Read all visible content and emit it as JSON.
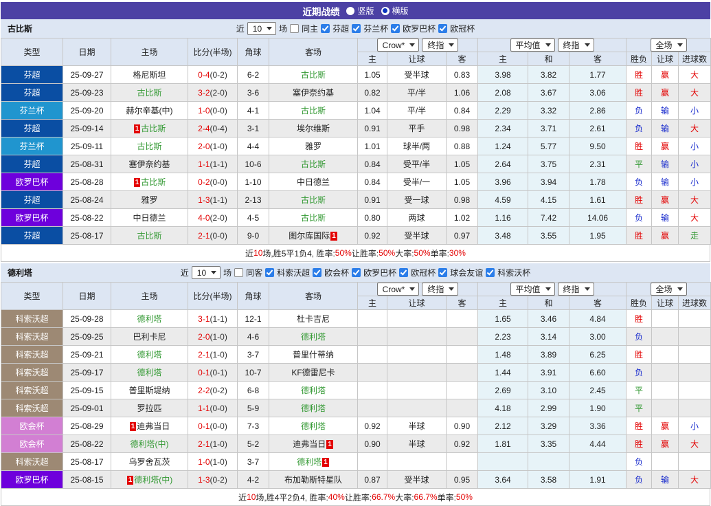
{
  "title_bar": {
    "title": "近期战绩",
    "radios": [
      {
        "label": "竖版",
        "selected": false
      },
      {
        "label": "横版",
        "selected": true
      }
    ]
  },
  "header": {
    "labels": [
      "类型",
      "日期",
      "主场",
      "比分(半场)",
      "角球",
      "客场"
    ],
    "selects": {
      "odds_company": "Crow*",
      "odds_final": "终指",
      "avg": "平均值",
      "avg_final": "终指",
      "scope": "全场"
    },
    "sub": [
      "主",
      "让球",
      "客",
      "主",
      "和",
      "客",
      "胜负",
      "让球",
      "进球数"
    ]
  },
  "type_colors": {
    "芬超": "#0a4ea3",
    "芬兰杯": "#2095cf",
    "欧罗巴杯": "#6e00dc",
    "科索沃超": "#9d8974",
    "欧会杯": "#d27fd3"
  },
  "result_colors": {
    "胜": "red",
    "赢": "red",
    "大": "red",
    "负": "blue",
    "输": "blue",
    "小": "blue",
    "平": "green",
    "走": "green"
  },
  "accent_colors": {
    "red": "#e30000",
    "blue": "#1326cc",
    "green": "#339933"
  },
  "tables": [
    {
      "team": "古比斯",
      "filter": {
        "prefix": "近",
        "games": "10",
        "suffix": "场",
        "same_label": "同主",
        "same_checked": false,
        "leagues": [
          "芬超",
          "芬兰杯",
          "欧罗巴杯",
          "欧冠杯"
        ]
      },
      "rows": [
        {
          "type": "芬超",
          "date": "25-09-27",
          "home": {
            "text": "格尼斯坦"
          },
          "score": "0-4",
          "half": "(0-2)",
          "corner": "6-2",
          "away": {
            "text": "古比斯",
            "green": true
          },
          "odds": [
            "1.05",
            "受半球",
            "0.83"
          ],
          "avg": [
            "3.98",
            "3.82",
            "1.77"
          ],
          "results": [
            "胜",
            "赢",
            "大"
          ]
        },
        {
          "type": "芬超",
          "date": "25-09-23",
          "home": {
            "text": "古比斯",
            "green": true
          },
          "score": "3-2",
          "half": "(2-0)",
          "corner": "3-6",
          "away": {
            "text": "塞伊奈约基"
          },
          "odds": [
            "0.82",
            "平/半",
            "1.06"
          ],
          "avg": [
            "2.08",
            "3.67",
            "3.06"
          ],
          "results": [
            "胜",
            "赢",
            "大"
          ]
        },
        {
          "type": "芬兰杯",
          "date": "25-09-20",
          "home": {
            "text": "赫尔辛基(中)"
          },
          "score": "1-0",
          "half": "(0-0)",
          "corner": "4-1",
          "away": {
            "text": "古比斯",
            "green": true
          },
          "odds": [
            "1.04",
            "平/半",
            "0.84"
          ],
          "avg": [
            "2.29",
            "3.32",
            "2.86"
          ],
          "results": [
            "负",
            "输",
            "小"
          ]
        },
        {
          "type": "芬超",
          "date": "25-09-14",
          "home": {
            "text": "古比斯",
            "green": true,
            "badge_before": true
          },
          "score": "2-4",
          "half": "(0-4)",
          "corner": "3-1",
          "away": {
            "text": "埃尔维斯"
          },
          "odds": [
            "0.91",
            "平手",
            "0.98"
          ],
          "avg": [
            "2.34",
            "3.71",
            "2.61"
          ],
          "results": [
            "负",
            "输",
            "大"
          ]
        },
        {
          "type": "芬兰杯",
          "date": "25-09-11",
          "home": {
            "text": "古比斯",
            "green": true
          },
          "score": "2-0",
          "half": "(1-0)",
          "corner": "4-4",
          "away": {
            "text": "雅罗"
          },
          "odds": [
            "1.01",
            "球半/两",
            "0.88"
          ],
          "avg": [
            "1.24",
            "5.77",
            "9.50"
          ],
          "results": [
            "胜",
            "赢",
            "小"
          ]
        },
        {
          "type": "芬超",
          "date": "25-08-31",
          "home": {
            "text": "塞伊奈约基"
          },
          "score": "1-1",
          "half": "(1-1)",
          "corner": "10-6",
          "away": {
            "text": "古比斯",
            "green": true
          },
          "odds": [
            "0.84",
            "受平/半",
            "1.05"
          ],
          "avg": [
            "2.64",
            "3.75",
            "2.31"
          ],
          "results": [
            "平",
            "输",
            "小"
          ]
        },
        {
          "type": "欧罗巴杯",
          "date": "25-08-28",
          "home": {
            "text": "古比斯",
            "green": true,
            "badge_before": true
          },
          "score": "0-2",
          "half": "(0-0)",
          "corner": "1-10",
          "away": {
            "text": "中日德兰"
          },
          "odds": [
            "0.84",
            "受半/一",
            "1.05"
          ],
          "avg": [
            "3.96",
            "3.94",
            "1.78"
          ],
          "results": [
            "负",
            "输",
            "小"
          ]
        },
        {
          "type": "芬超",
          "date": "25-08-24",
          "home": {
            "text": "雅罗"
          },
          "score": "1-3",
          "half": "(1-1)",
          "corner": "2-13",
          "away": {
            "text": "古比斯",
            "green": true
          },
          "odds": [
            "0.91",
            "受一球",
            "0.98"
          ],
          "avg": [
            "4.59",
            "4.15",
            "1.61"
          ],
          "results": [
            "胜",
            "赢",
            "大"
          ]
        },
        {
          "type": "欧罗巴杯",
          "date": "25-08-22",
          "home": {
            "text": "中日德兰"
          },
          "score": "4-0",
          "half": "(2-0)",
          "corner": "4-5",
          "away": {
            "text": "古比斯",
            "green": true
          },
          "odds": [
            "0.80",
            "两球",
            "1.02"
          ],
          "avg": [
            "1.16",
            "7.42",
            "14.06"
          ],
          "results": [
            "负",
            "输",
            "大"
          ]
        },
        {
          "type": "芬超",
          "date": "25-08-17",
          "home": {
            "text": "古比斯",
            "green": true
          },
          "score": "2-1",
          "half": "(0-0)",
          "corner": "9-0",
          "away": {
            "text": "图尔库国际",
            "badge_after": true
          },
          "odds": [
            "0.92",
            "受半球",
            "0.97"
          ],
          "avg": [
            "3.48",
            "3.55",
            "1.95"
          ],
          "results": [
            "胜",
            "赢",
            "走"
          ]
        }
      ],
      "summary": [
        {
          "text": "近"
        },
        {
          "text": "10",
          "red": true
        },
        {
          "text": "场,胜5平1负4, 胜率:"
        },
        {
          "text": "50%",
          "red": true
        },
        {
          "text": " 让胜率:"
        },
        {
          "text": "50%",
          "red": true
        },
        {
          "text": " 大率:"
        },
        {
          "text": "50%",
          "red": true
        },
        {
          "text": " 单率:"
        },
        {
          "text": "30%",
          "red": true
        }
      ]
    },
    {
      "team": "德利塔",
      "filter": {
        "prefix": "近",
        "games": "10",
        "suffix": "场",
        "same_label": "同客",
        "same_checked": false,
        "leagues": [
          "科索沃超",
          "欧会杯",
          "欧罗巴杯",
          "欧冠杯",
          "球会友谊",
          "科索沃杯"
        ]
      },
      "rows": [
        {
          "type": "科索沃超",
          "date": "25-09-28",
          "home": {
            "text": "德利塔",
            "green": true
          },
          "score": "3-1",
          "half": "(1-1)",
          "corner": "12-1",
          "away": {
            "text": "杜卡吉尼"
          },
          "odds": [
            "",
            "",
            ""
          ],
          "avg": [
            "1.65",
            "3.46",
            "4.84"
          ],
          "results": [
            "胜",
            "",
            ""
          ]
        },
        {
          "type": "科索沃超",
          "date": "25-09-25",
          "home": {
            "text": "巴利卡尼"
          },
          "score": "2-0",
          "half": "(1-0)",
          "corner": "4-6",
          "away": {
            "text": "德利塔",
            "green": true
          },
          "odds": [
            "",
            "",
            ""
          ],
          "avg": [
            "2.23",
            "3.14",
            "3.00"
          ],
          "results": [
            "负",
            "",
            ""
          ]
        },
        {
          "type": "科索沃超",
          "date": "25-09-21",
          "home": {
            "text": "德利塔",
            "green": true
          },
          "score": "2-1",
          "half": "(1-0)",
          "corner": "3-7",
          "away": {
            "text": "普里什蒂纳"
          },
          "odds": [
            "",
            "",
            ""
          ],
          "avg": [
            "1.48",
            "3.89",
            "6.25"
          ],
          "results": [
            "胜",
            "",
            ""
          ]
        },
        {
          "type": "科索沃超",
          "date": "25-09-17",
          "home": {
            "text": "德利塔",
            "green": true
          },
          "score": "0-1",
          "half": "(0-1)",
          "corner": "10-7",
          "away": {
            "text": "KF德雷尼卡"
          },
          "odds": [
            "",
            "",
            ""
          ],
          "avg": [
            "1.44",
            "3.91",
            "6.60"
          ],
          "results": [
            "负",
            "",
            ""
          ]
        },
        {
          "type": "科索沃超",
          "date": "25-09-15",
          "home": {
            "text": "普里斯堤纳"
          },
          "score": "2-2",
          "half": "(0-2)",
          "corner": "6-8",
          "away": {
            "text": "德利塔",
            "green": true
          },
          "odds": [
            "",
            "",
            ""
          ],
          "avg": [
            "2.69",
            "3.10",
            "2.45"
          ],
          "results": [
            "平",
            "",
            ""
          ]
        },
        {
          "type": "科索沃超",
          "date": "25-09-01",
          "home": {
            "text": "罗拉匹"
          },
          "score": "1-1",
          "half": "(0-0)",
          "corner": "5-9",
          "away": {
            "text": "德利塔",
            "green": true
          },
          "odds": [
            "",
            "",
            ""
          ],
          "avg": [
            "4.18",
            "2.99",
            "1.90"
          ],
          "results": [
            "平",
            "",
            ""
          ]
        },
        {
          "type": "欧会杯",
          "date": "25-08-29",
          "home": {
            "text": "迪弗当日",
            "badge_before": true
          },
          "score": "0-1",
          "half": "(0-0)",
          "corner": "7-3",
          "away": {
            "text": "德利塔",
            "green": true
          },
          "odds": [
            "0.92",
            "半球",
            "0.90"
          ],
          "avg": [
            "2.12",
            "3.29",
            "3.36"
          ],
          "results": [
            "胜",
            "赢",
            "小"
          ]
        },
        {
          "type": "欧会杯",
          "date": "25-08-22",
          "home": {
            "text": "德利塔(中)",
            "green": true
          },
          "score": "2-1",
          "half": "(1-0)",
          "corner": "5-2",
          "away": {
            "text": "迪弗当日",
            "badge_after": true
          },
          "odds": [
            "0.90",
            "半球",
            "0.92"
          ],
          "avg": [
            "1.81",
            "3.35",
            "4.44"
          ],
          "results": [
            "胜",
            "赢",
            "大"
          ]
        },
        {
          "type": "科索沃超",
          "date": "25-08-17",
          "home": {
            "text": "乌罗舍瓦茨"
          },
          "score": "1-0",
          "half": "(1-0)",
          "corner": "3-7",
          "away": {
            "text": "德利塔",
            "green": true,
            "badge_after": true
          },
          "odds": [
            "",
            "",
            ""
          ],
          "avg": [
            "",
            "",
            ""
          ],
          "results": [
            "负",
            "",
            ""
          ]
        },
        {
          "type": "欧罗巴杯",
          "date": "25-08-15",
          "home": {
            "text": "德利塔(中)",
            "green": true,
            "badge_before": true
          },
          "score": "1-3",
          "half": "(0-2)",
          "corner": "4-2",
          "away": {
            "text": "布加勒斯特星队"
          },
          "odds": [
            "0.87",
            "受半球",
            "0.95"
          ],
          "avg": [
            "3.64",
            "3.58",
            "1.91"
          ],
          "results": [
            "负",
            "输",
            "大"
          ]
        }
      ],
      "summary": [
        {
          "text": "近"
        },
        {
          "text": "10",
          "red": true
        },
        {
          "text": "场,胜4平2负4, 胜率:"
        },
        {
          "text": "40%",
          "red": true
        },
        {
          "text": " 让胜率:"
        },
        {
          "text": "66.7%",
          "red": true
        },
        {
          "text": " 大率:"
        },
        {
          "text": "66.7%",
          "red": true
        },
        {
          "text": " 单率:"
        },
        {
          "text": "50%",
          "red": true
        }
      ]
    }
  ]
}
